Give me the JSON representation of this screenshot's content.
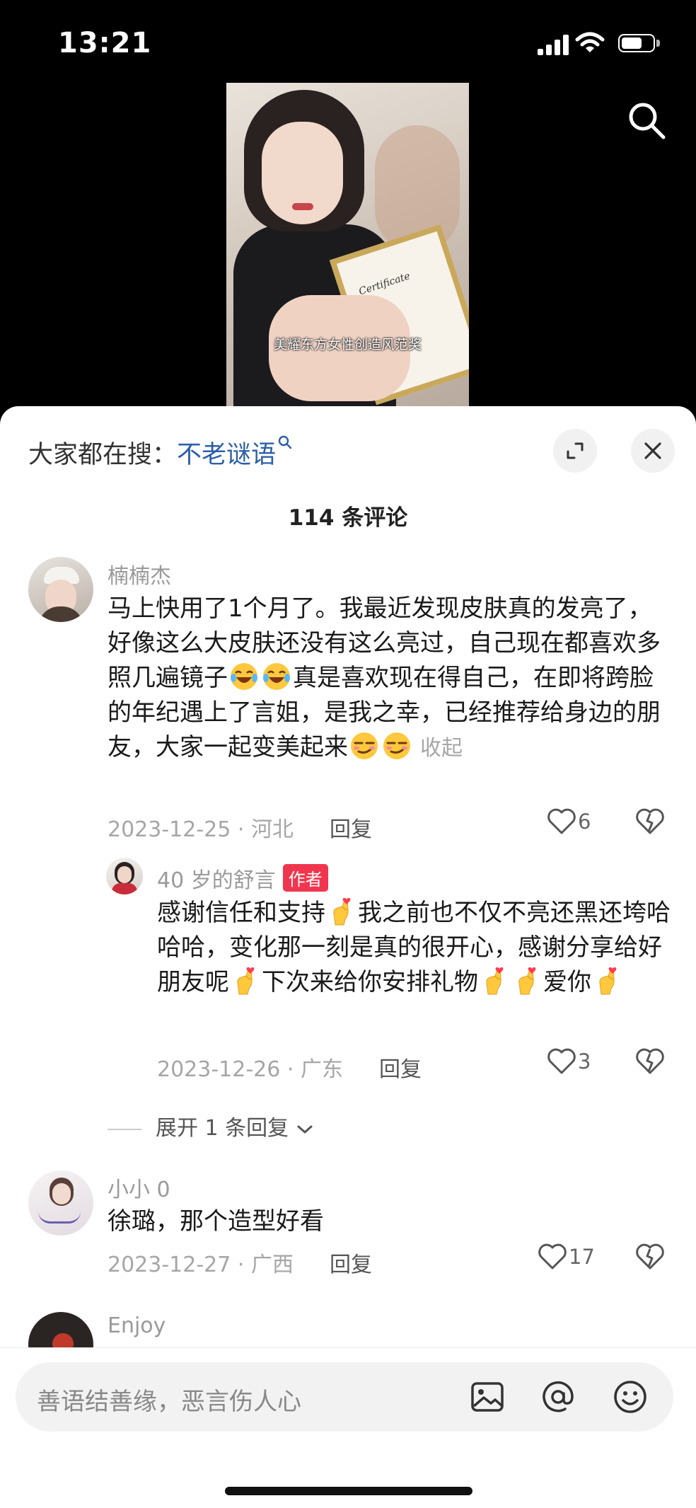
{
  "status_bar": {
    "time": "13:21"
  },
  "video": {
    "caption": "美耀东方女性创造风范奖",
    "certificate_text": "Certificate"
  },
  "hot_search": {
    "prefix": "大家都在搜：",
    "keyword": "不老谜语"
  },
  "comments_header": {
    "count_label": "114 条评论"
  },
  "comments": [
    {
      "user": "楠楠杰",
      "text_parts": [
        "马上快用了1个月了。我最近发现皮肤真的发亮了，好像这么大皮肤还没有这么亮过，自己现在都喜欢多照几遍镜子",
        "真是喜欢现在得自己，在即将跨脸的年纪遇上了言姐，是我之幸，已经推荐给身边的朋友，大家一起变美起来"
      ],
      "emoji": [
        "laughing-tears",
        "laughing-tears",
        "smirk",
        "smirk"
      ],
      "collapse_label": "收起",
      "date_location": "2023-12-25 · 河北",
      "reply_label": "回复",
      "likes": "6"
    },
    {
      "user": "40 岁的舒言",
      "badge": "作者",
      "text_parts": [
        "感谢信任和支持",
        "我之前也不仅不亮还黑还垮哈哈哈，变化那一刻是真的很开心，感谢分享给好朋友呢",
        "下次来给你安排礼物",
        "爱你"
      ],
      "emoji": [
        "finger-heart"
      ],
      "date_location": "2023-12-26 · 广东",
      "reply_label": "回复",
      "likes": "3"
    },
    {
      "user": "小小 0",
      "text": "徐璐，那个造型好看",
      "date_location": "2023-12-27 · 广西",
      "reply_label": "回复",
      "likes": "17"
    },
    {
      "user": "Enjoy"
    }
  ],
  "expand_replies": {
    "label": "展开 1 条回复"
  },
  "input": {
    "placeholder": "善语结善缘，恶言伤人心"
  },
  "colors": {
    "accent_blue": "#2c5fa8",
    "author_badge": "#f0364e",
    "panel_bg": "#ffffff"
  },
  "icons": [
    "search-icon",
    "expand-icon",
    "close-icon",
    "heart-icon",
    "dislike-icon",
    "image-icon",
    "at-icon",
    "emoji-icon"
  ]
}
